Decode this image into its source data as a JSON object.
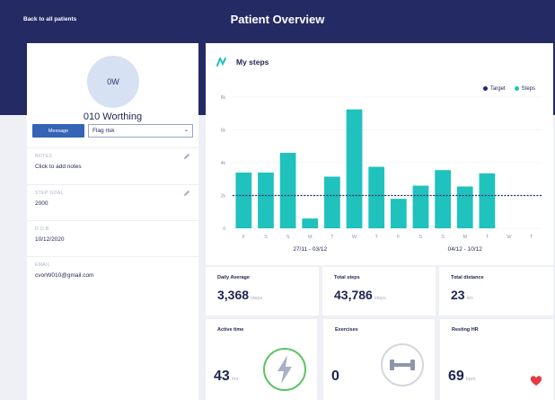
{
  "header": {
    "back_link": "Back to all patients",
    "title": "Patient Overview"
  },
  "patient": {
    "initials": "0W",
    "name": "010 Worthing",
    "message_button": "Message",
    "flag_select": "Flag risk",
    "fields": [
      {
        "label": "NOTES",
        "value": "Click to add notes",
        "editable": true
      },
      {
        "label": "STEP GOAL",
        "value": "2000",
        "editable": true
      },
      {
        "label": "D.O.B",
        "value": "10/12/2020",
        "editable": false
      },
      {
        "label": "EMAIL",
        "value": "cvorW010@gmail.com",
        "editable": false
      }
    ]
  },
  "steps_card": {
    "title": "My steps",
    "legend": [
      {
        "label": "Target",
        "color": "#1f2c6b"
      },
      {
        "label": "Steps",
        "color": "#1fc2bd"
      }
    ],
    "range_labels": [
      "27/11 - 03/12",
      "04/12 - 10/12"
    ]
  },
  "chart_data": {
    "type": "bar",
    "categories": [
      "F",
      "S",
      "S",
      "M",
      "T",
      "W",
      "T",
      "F",
      "S",
      "S",
      "M",
      "T",
      "W",
      "T"
    ],
    "series": [
      {
        "name": "Steps",
        "values": [
          3400,
          3400,
          4600,
          600,
          3150,
          7250,
          3750,
          1800,
          2600,
          3550,
          2550,
          3350,
          0,
          0
        ]
      },
      {
        "name": "Target",
        "values": [
          2000,
          2000,
          2000,
          2000,
          2000,
          2000,
          2000,
          2000,
          2000,
          2000,
          2000,
          2000,
          2000,
          2000
        ]
      }
    ],
    "yticks": [
      "0",
      "2k",
      "4k",
      "6k",
      "8k"
    ],
    "ylim": [
      0,
      8000
    ],
    "grid": true,
    "legend_position": "top-right",
    "colors": {
      "steps": "#1fc2bd",
      "target": "#1f2c6b"
    }
  },
  "stats": [
    {
      "label": "Daily Average",
      "value": "3,368",
      "unit": "steps"
    },
    {
      "label": "Total steps",
      "value": "43,786",
      "unit": "steps"
    },
    {
      "label": "Total distance",
      "value": "23",
      "unit": "km"
    }
  ],
  "bottom_cards": [
    {
      "label": "Active time",
      "value": "43",
      "unit": "hrs",
      "icon": "lightning-icon",
      "accent": "#5fc469"
    },
    {
      "label": "Exercises",
      "value": "0",
      "unit": "",
      "icon": "dumbbell-icon",
      "accent": "#d4d7df"
    },
    {
      "label": "Resting HR",
      "value": "69",
      "unit": "bpm",
      "icon": "heart-icon",
      "accent": "#e53a45"
    }
  ]
}
